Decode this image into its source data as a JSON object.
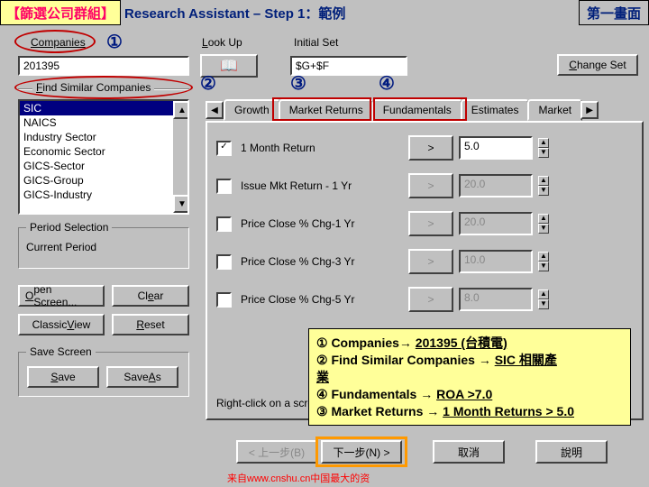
{
  "header": {
    "bracket": "【篩選公司群組】",
    "title": "Research Assistant – Step 1：範例",
    "right": "第一畫面"
  },
  "labels": {
    "companies": "Companies",
    "lookup": "Look Up",
    "initial_set": "Initial Set",
    "find_similar": "Find Similar Companies",
    "period_selection": "Period Selection",
    "current_period": "Current Period"
  },
  "inputs": {
    "company_value": "201395",
    "initialset_value": "$G+$F"
  },
  "similar_list": [
    "SIC",
    "NAICS",
    "Industry Sector",
    "Economic Sector",
    "GICS-Sector",
    "GICS-Group",
    "GICS-Industry"
  ],
  "buttons": {
    "change_set": "Change Set",
    "open_screen": "Open Screen...",
    "clear": "Clear",
    "classic_view": "Classic View",
    "reset": "Reset",
    "save_screen": "Save Screen",
    "save": "Save",
    "save_as": "Save As",
    "back": "< 上一步(B)",
    "next": "下一步(N) >",
    "cancel": "取消",
    "help": "說明"
  },
  "tabs": {
    "growth": "Growth",
    "market_returns": "Market Returns",
    "fundamentals": "Fundamentals",
    "estimates": "Estimates",
    "market_more": "Market"
  },
  "rows": [
    {
      "label": "1 Month Return",
      "op": ">",
      "val": "5.0",
      "checked": true,
      "enabled": true
    },
    {
      "label": "Issue Mkt Return - 1 Yr",
      "op": ">",
      "val": "20.0",
      "checked": false,
      "enabled": false
    },
    {
      "label": "Price Close % Chg-1 Yr",
      "op": ">",
      "val": "20.0",
      "checked": false,
      "enabled": false
    },
    {
      "label": "Price Close % Chg-3 Yr",
      "op": ">",
      "val": "10.0",
      "checked": false,
      "enabled": false
    },
    {
      "label": "Price Close % Chg-5 Yr",
      "op": ">",
      "val": "8.0",
      "checked": false,
      "enabled": false
    }
  ],
  "hint": "Right-click on a screen item for a definition of",
  "annotation": {
    "l1a": "① Companies",
    "l1b": "201395 (台積電)",
    "l2a": "② Find Similar Companies",
    "l2b": "SIC 相關產",
    "l2c": "業",
    "l3a": "④ Fundamentals",
    "l3b": "ROA >7.0",
    "l4a": "③ Market Returns",
    "l4b": "1 Month Returns > 5.0"
  },
  "nums": {
    "n1": "①",
    "n2": "②",
    "n3": "③",
    "n4": "④"
  },
  "footer": "来自www.cnshu.cn中国最大的资"
}
